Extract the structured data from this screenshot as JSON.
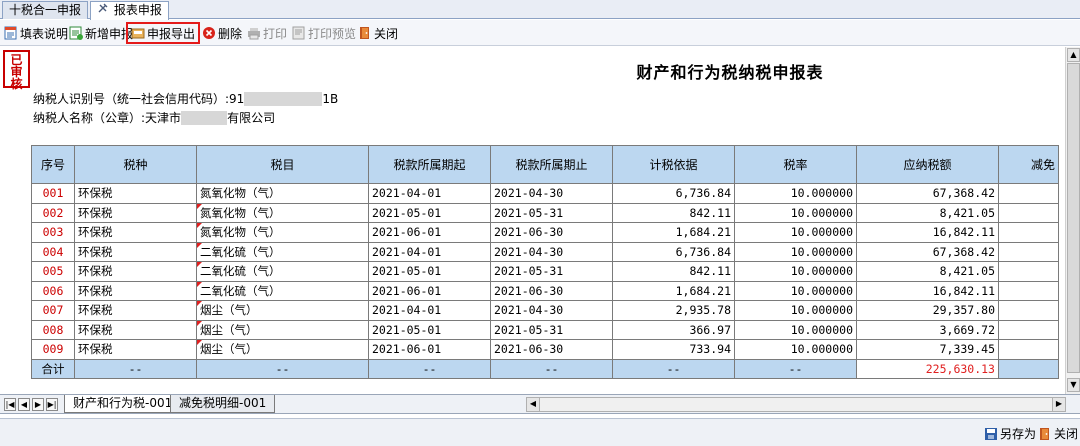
{
  "top_tabs": [
    {
      "label": "十税合一申报"
    },
    {
      "label": "报表申报"
    }
  ],
  "toolbar": {
    "fill_help": "填表说明",
    "add_declaration": "新增申报",
    "export_declaration": "申报导出",
    "delete": "删除",
    "print": "打印",
    "print_preview": "打印预览",
    "close": "关闭"
  },
  "stamp": {
    "text": "已审核"
  },
  "form": {
    "title": "财产和行为税纳税申报表",
    "taxpayer_id_label": "纳税人识别号（统一社会信用代码）:",
    "taxpayer_id_prefix": "91",
    "taxpayer_id_suffix": "1B",
    "taxpayer_name_label": "纳税人名称（公章）:",
    "taxpayer_name_prefix": "天津市",
    "taxpayer_name_suffix": "有限公司"
  },
  "table": {
    "headers": [
      "序号",
      "税种",
      "税目",
      "税款所属期起",
      "税款所属期止",
      "计税依据",
      "税率",
      "应纳税额",
      "减免"
    ],
    "rows": [
      {
        "seq": "001",
        "tax_type": "环保税",
        "item": "氮氧化物（气）",
        "start": "2021-04-01",
        "end": "2021-04-30",
        "basis": "6,736.84",
        "rate": "10.000000",
        "payable": "67,368.42",
        "reduce": ""
      },
      {
        "seq": "002",
        "tax_type": "环保税",
        "item": "氮氧化物（气）",
        "start": "2021-05-01",
        "end": "2021-05-31",
        "basis": "842.11",
        "rate": "10.000000",
        "payable": "8,421.05",
        "reduce": ""
      },
      {
        "seq": "003",
        "tax_type": "环保税",
        "item": "氮氧化物（气）",
        "start": "2021-06-01",
        "end": "2021-06-30",
        "basis": "1,684.21",
        "rate": "10.000000",
        "payable": "16,842.11",
        "reduce": ""
      },
      {
        "seq": "004",
        "tax_type": "环保税",
        "item": "二氧化硫（气）",
        "start": "2021-04-01",
        "end": "2021-04-30",
        "basis": "6,736.84",
        "rate": "10.000000",
        "payable": "67,368.42",
        "reduce": ""
      },
      {
        "seq": "005",
        "tax_type": "环保税",
        "item": "二氧化硫（气）",
        "start": "2021-05-01",
        "end": "2021-05-31",
        "basis": "842.11",
        "rate": "10.000000",
        "payable": "8,421.05",
        "reduce": ""
      },
      {
        "seq": "006",
        "tax_type": "环保税",
        "item": "二氧化硫（气）",
        "start": "2021-06-01",
        "end": "2021-06-30",
        "basis": "1,684.21",
        "rate": "10.000000",
        "payable": "16,842.11",
        "reduce": ""
      },
      {
        "seq": "007",
        "tax_type": "环保税",
        "item": "烟尘（气）",
        "start": "2021-04-01",
        "end": "2021-04-30",
        "basis": "2,935.78",
        "rate": "10.000000",
        "payable": "29,357.80",
        "reduce": ""
      },
      {
        "seq": "008",
        "tax_type": "环保税",
        "item": "烟尘（气）",
        "start": "2021-05-01",
        "end": "2021-05-31",
        "basis": "366.97",
        "rate": "10.000000",
        "payable": "3,669.72",
        "reduce": ""
      },
      {
        "seq": "009",
        "tax_type": "环保税",
        "item": "烟尘（气）",
        "start": "2021-06-01",
        "end": "2021-06-30",
        "basis": "733.94",
        "rate": "10.000000",
        "payable": "7,339.45",
        "reduce": ""
      }
    ],
    "total": {
      "label": "合计",
      "dash": "--",
      "payable": "225,630.13"
    }
  },
  "sheet_tabs": [
    {
      "label": "财产和行为税-001"
    },
    {
      "label": "减免税明细-001"
    }
  ],
  "status_bar": {
    "save_as": "另存为",
    "close": "关闭"
  },
  "colors": {
    "header_bg": "#bcd7f0",
    "seq_red": "#cc0000",
    "highlight_border": "#e41a1a",
    "stamp_red": "#c80000"
  }
}
